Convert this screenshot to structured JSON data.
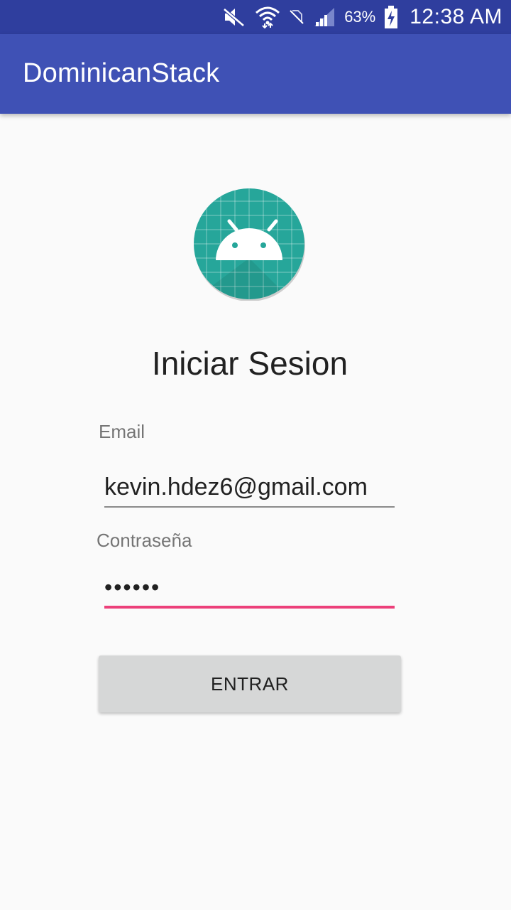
{
  "status_bar": {
    "battery_percent": "63%",
    "time": "12:38 AM",
    "icons": [
      "mute-icon",
      "wifi-icon",
      "no-sim-icon",
      "signal-icon",
      "battery-charging-icon"
    ]
  },
  "app_bar": {
    "title": "DominicanStack"
  },
  "login": {
    "icon": "android-app-icon",
    "title": "Iniciar Sesion",
    "email_label": "Email",
    "email_value": "kevin.hdez6@gmail.com",
    "password_label": "Contraseña",
    "password_value": "••••••",
    "submit_label": "ENTRAR"
  },
  "colors": {
    "status_bar": "#2f3e9e",
    "app_bar": "#3f51b5",
    "accent": "#ec407a",
    "icon_background": "#26a69a",
    "button_background": "#d6d7d7"
  }
}
